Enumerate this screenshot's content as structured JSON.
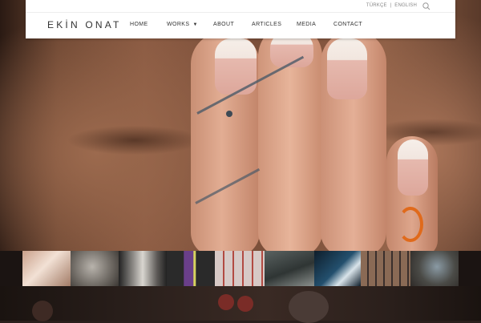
{
  "header": {
    "logo": "EKİN ONAT",
    "languages": [
      {
        "label": "TÜRKÇE",
        "sep": " | "
      },
      {
        "label": "ENGLISH"
      }
    ],
    "nav": [
      {
        "label": "HOME"
      },
      {
        "label": "WORKS",
        "has_dropdown": true
      },
      {
        "label": "ABOUT"
      },
      {
        "label": "ARTICLES"
      },
      {
        "label": "MEDIA"
      },
      {
        "label": "CONTACT"
      }
    ],
    "icons": {
      "search": "search-icon",
      "dropdown": "caret-down-icon"
    }
  },
  "colors": {
    "header_bg": "#ffffff",
    "text": "#333333",
    "muted": "#888888",
    "background": "#2a1f1c"
  }
}
